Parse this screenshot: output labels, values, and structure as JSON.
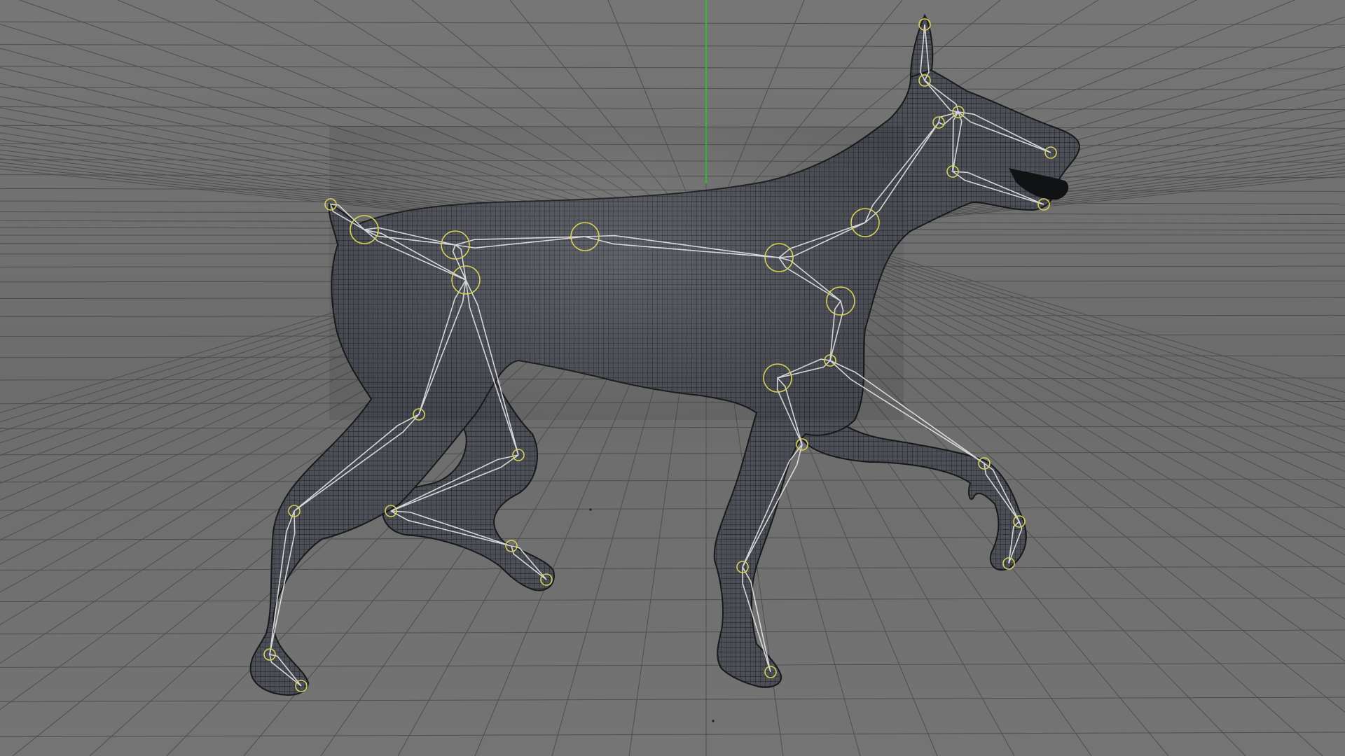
{
  "viewport": {
    "view": "perspective",
    "background_color": "#707070",
    "grid_color": "#4a4a4a",
    "axis_y_color": "#2bbf2b",
    "mesh_fill": "#4a4d54",
    "mesh_wire": "#1c1c1e",
    "bone_color": "#e6e6e6",
    "joint_color": "#d8d25a",
    "grid_visible": true,
    "subject": "rigged-dog-mesh",
    "joints_visible": true
  }
}
